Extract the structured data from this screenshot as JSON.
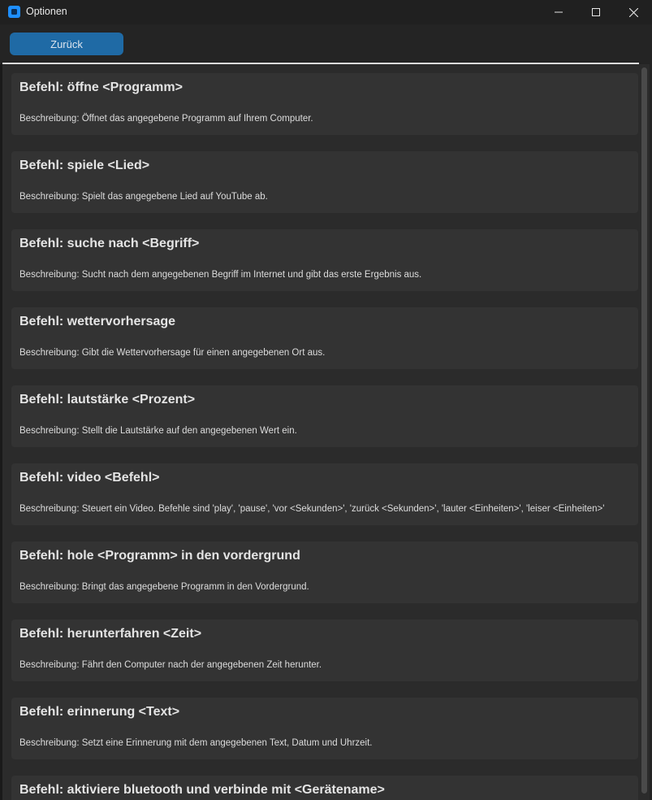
{
  "window": {
    "title": "Optionen",
    "app_icon": "app-logo-icon",
    "controls": [
      "minimize-icon",
      "maximize-icon",
      "close-icon"
    ]
  },
  "toolbar": {
    "back_label": "Zurück"
  },
  "colors": {
    "accent": "#1f6aa5",
    "card_bg": "#333333",
    "panel_bg": "#2b2b2b"
  },
  "commands": [
    {
      "title": "Befehl: öffne <Programm>",
      "description": "Beschreibung: Öffnet das angegebene Programm auf Ihrem Computer."
    },
    {
      "title": "Befehl: spiele <Lied>",
      "description": "Beschreibung: Spielt das angegebene Lied auf YouTube ab."
    },
    {
      "title": "Befehl: suche nach <Begriff>",
      "description": "Beschreibung: Sucht nach dem angegebenen Begriff im Internet und gibt das erste Ergebnis aus."
    },
    {
      "title": "Befehl: wettervorhersage",
      "description": "Beschreibung: Gibt die Wettervorhersage für einen angegebenen Ort aus."
    },
    {
      "title": "Befehl: lautstärke <Prozent>",
      "description": "Beschreibung: Stellt die Lautstärke auf den angegebenen Wert ein."
    },
    {
      "title": "Befehl: video <Befehl>",
      "description": "Beschreibung: Steuert ein Video. Befehle sind 'play', 'pause', 'vor <Sekunden>', 'zurück <Sekunden>', 'lauter <Einheiten>', 'leiser <Einheiten>'"
    },
    {
      "title": "Befehl: hole <Programm> in den vordergrund",
      "description": "Beschreibung: Bringt das angegebene Programm in den Vordergrund."
    },
    {
      "title": "Befehl: herunterfahren <Zeit>",
      "description": "Beschreibung: Fährt den Computer nach der angegebenen Zeit herunter."
    },
    {
      "title": "Befehl: erinnerung <Text>",
      "description": "Beschreibung: Setzt eine Erinnerung mit dem angegebenen Text, Datum und Uhrzeit."
    },
    {
      "title": "Befehl: aktiviere bluetooth und verbinde mit <Gerätename>",
      "description": ""
    }
  ]
}
